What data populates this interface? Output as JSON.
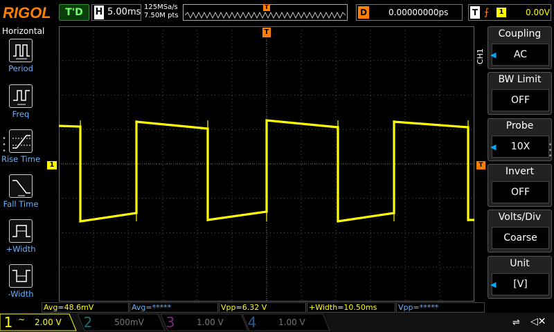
{
  "top": {
    "brand": "RIGOL",
    "status": "T'D",
    "h_letter": "H",
    "timebase": "5.00ms",
    "sample_rate": "125MSa/s",
    "memory_depth": "7.50M pts",
    "delay_letter": "D",
    "delay_value": "0.00000000ps",
    "trigger_letter": "T",
    "trigger_channel": "1",
    "trigger_level": "0.00V"
  },
  "left_menu": {
    "title": "Horizontal",
    "items": [
      {
        "label": "Period"
      },
      {
        "label": "Freq"
      },
      {
        "label": "Rise Time"
      },
      {
        "label": "Fall Time"
      },
      {
        "label": "+Width"
      },
      {
        "label": "-Width"
      }
    ]
  },
  "right_menu": {
    "channel_tag": "CH1",
    "items": [
      {
        "title": "Coupling",
        "value": "AC"
      },
      {
        "title": "BW Limit",
        "value": "OFF"
      },
      {
        "title": "Probe",
        "value": "10X"
      },
      {
        "title": "Invert",
        "value": "OFF"
      },
      {
        "title": "Volts/Div",
        "value": "Coarse"
      },
      {
        "title": "Unit",
        "value": "[V]"
      }
    ]
  },
  "measurements": [
    {
      "text": "Avg=48.6mV"
    },
    {
      "text": "Avg=*****"
    },
    {
      "text": "Vpp=6.32 V"
    },
    {
      "text": "+Width=10.50ms"
    },
    {
      "text": "Vpp=*****"
    }
  ],
  "channels": [
    {
      "num": "1",
      "coupling": "~",
      "scale": "2.00 V",
      "color": "#ffff00"
    },
    {
      "num": "2",
      "scale": "500mV",
      "color": "#00b3b3"
    },
    {
      "num": "3",
      "scale": "1.00 V",
      "color": "#cc33cc"
    },
    {
      "num": "4",
      "scale": "1.00 V",
      "color": "#3399ff"
    }
  ],
  "markers": {
    "ch1_level": "1",
    "trigger_top": "T",
    "trigger_right": "T"
  },
  "colors": {
    "ch1": "#ffff00",
    "accent": "#ff7f00",
    "menu_label": "#66b3ff"
  }
}
